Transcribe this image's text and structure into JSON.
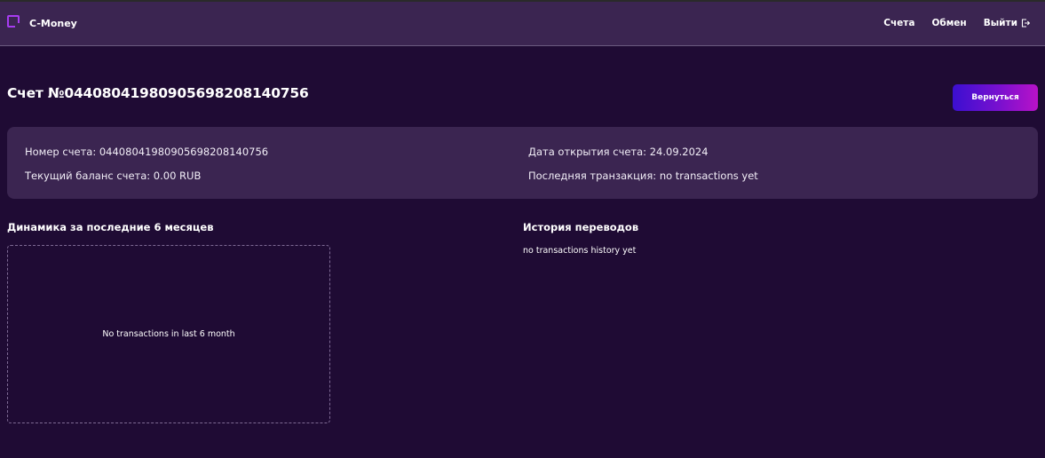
{
  "header": {
    "brand": "C-Money",
    "nav": {
      "accounts": "Счета",
      "exchange": "Обмен",
      "logout": "Выйти"
    }
  },
  "page": {
    "title": "Счет №04408041980905698208140756",
    "back_button": "Вернуться"
  },
  "account_info": {
    "number": "Номер счета: 04408041980905698208140756",
    "balance": "Текущий баланс счета: 0.00 RUB",
    "open_date": "Дата открытия счета: 24.09.2024",
    "last_transaction": "Последняя транзакция: no transactions yet"
  },
  "dynamics": {
    "title": "Динамика за последние 6 месяцев",
    "empty_text": "No transactions in last 6 month"
  },
  "history": {
    "title": "История переводов",
    "empty_text": "no transactions history yet"
  },
  "colors": {
    "background": "#1f0b34",
    "panel": "#3b2551",
    "accent_start": "#3b0fd0",
    "accent_end": "#b812c8",
    "logo": "#a73cf0"
  },
  "icons": {
    "logo": "square-logo-icon",
    "logout": "logout-icon"
  }
}
